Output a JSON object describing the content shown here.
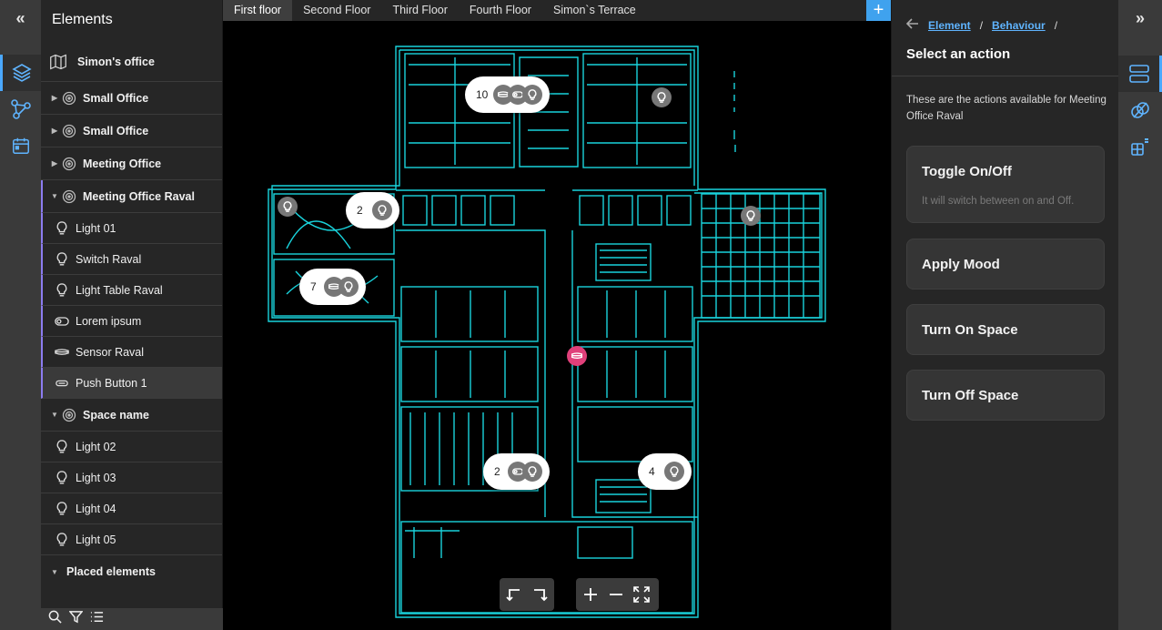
{
  "left_rail": {
    "collapse_label": "«",
    "items": [
      {
        "name": "layers-icon"
      },
      {
        "name": "flow-nodes-icon"
      },
      {
        "name": "calendar-icon"
      }
    ]
  },
  "elements_panel": {
    "title": "Elements",
    "items": [
      {
        "label": "Simon's office",
        "kind": "map",
        "bold": true
      },
      {
        "label": "Small Office",
        "kind": "space",
        "bold": true
      },
      {
        "label": "Small Office",
        "kind": "space",
        "bold": true
      },
      {
        "label": "Meeting Office",
        "kind": "space",
        "bold": true
      },
      {
        "label": "Meeting Office Raval",
        "kind": "space",
        "bold": true,
        "expanded": true
      },
      {
        "label": "Light 01",
        "kind": "bulb"
      },
      {
        "label": "Switch Raval",
        "kind": "bulb"
      },
      {
        "label": "Light Table Raval",
        "kind": "bulb"
      },
      {
        "label": "Lorem ipsum",
        "kind": "switch"
      },
      {
        "label": "Sensor Raval",
        "kind": "sensor"
      },
      {
        "label": "Push Button 1",
        "kind": "button",
        "selected": true
      },
      {
        "label": "Space name",
        "kind": "space",
        "bold": true,
        "expanded": true
      },
      {
        "label": "Light 02",
        "kind": "bulb"
      },
      {
        "label": "Light 03",
        "kind": "bulb"
      },
      {
        "label": "Light 04",
        "kind": "bulb"
      },
      {
        "label": "Light 05",
        "kind": "bulb"
      },
      {
        "label": "Placed elements",
        "kind": "none",
        "bold": true,
        "expanded": true
      }
    ]
  },
  "floor_tabs": {
    "tabs": [
      "First floor",
      "Second Floor",
      "Third Floor",
      "Fourth Floor",
      "Simon`s Terrace"
    ],
    "active_index": 0,
    "add_label": "+"
  },
  "map": {
    "pins": [
      {
        "count": "10"
      },
      {
        "count": "2"
      },
      {
        "count": "7"
      },
      {
        "count": "2"
      },
      {
        "count": "4"
      }
    ],
    "line_color": "#19d3dc",
    "highlight_color": "#e0407a"
  },
  "right_panel": {
    "crumb_1": "Element",
    "crumb_2": "Behaviour",
    "separator": "/",
    "title": "Select an action",
    "description": "These are the actions available for Meeting Office Raval",
    "actions": [
      {
        "label": "Toggle On/Off",
        "sub": "It will switch between on and Off."
      },
      {
        "label": "Apply Mood"
      },
      {
        "label": "Turn On Space"
      },
      {
        "label": "Turn Off Space"
      }
    ]
  },
  "right_rail": {
    "expand_label": "»"
  },
  "colors": {
    "accent": "#3fa2ee",
    "link": "#5fb4ff",
    "tree_selection": "#8c7cf0"
  }
}
